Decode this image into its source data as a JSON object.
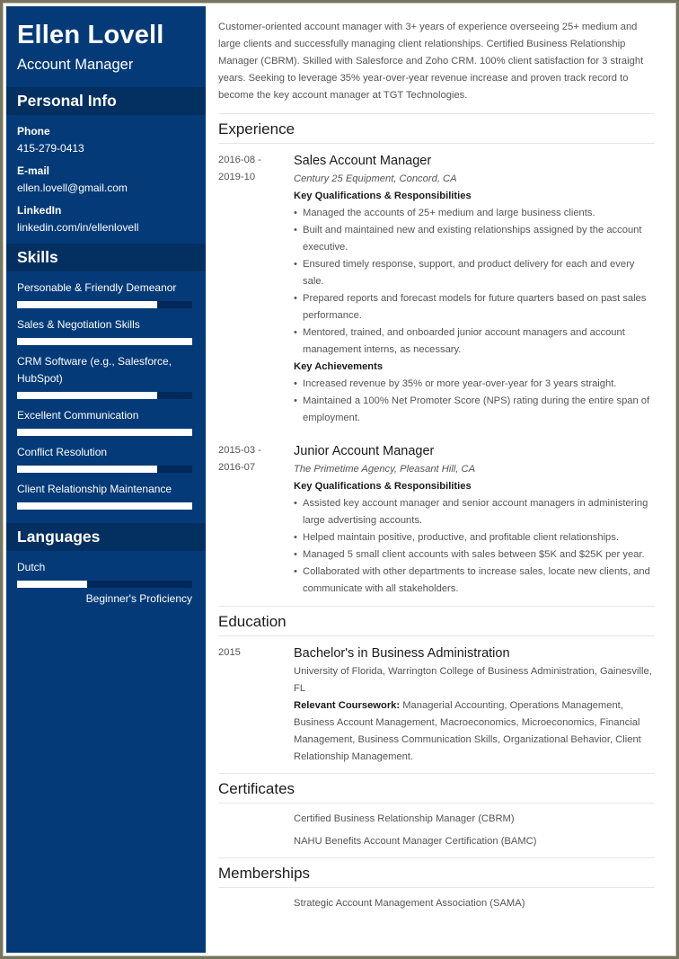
{
  "header": {
    "name": "Ellen Lovell",
    "title": "Account Manager"
  },
  "colors": {
    "sidebar": "#043a78",
    "sidebar_section": "#032f61",
    "frame": "#75755f"
  },
  "personal_info": {
    "title": "Personal Info",
    "items": [
      {
        "label": "Phone",
        "value": "415-279-0413"
      },
      {
        "label": "E-mail",
        "value": "ellen.lovell@gmail.com"
      },
      {
        "label": "LinkedIn",
        "value": "linkedin.com/in/ellenlovell"
      }
    ]
  },
  "skills": {
    "title": "Skills",
    "items": [
      {
        "label": "Personable & Friendly Demeanor",
        "level_percent": 80
      },
      {
        "label": "Sales & Negotiation Skills",
        "level_percent": 100
      },
      {
        "label": "CRM Software (e.g., Salesforce, HubSpot)",
        "level_percent": 80
      },
      {
        "label": "Excellent Communication",
        "level_percent": 100
      },
      {
        "label": "Conflict Resolution",
        "level_percent": 80
      },
      {
        "label": "Client Relationship Maintenance",
        "level_percent": 100
      }
    ]
  },
  "languages": {
    "title": "Languages",
    "items": [
      {
        "label": "Dutch",
        "level_percent": 40,
        "proficiency": "Beginner's Proficiency"
      }
    ]
  },
  "summary": "Customer-oriented account manager with 3+ years of experience overseeing 25+ medium and large clients and successfully managing client relationships. Certified Business Relationship Manager (CBRM). Skilled with Salesforce and Zoho CRM. 100% client satisfaction for 3 straight years. Seeking to leverage 35% year-over-year revenue increase and proven track record to become the key account manager at TGT Technologies.",
  "experience": {
    "title": "Experience",
    "jobs": [
      {
        "date_start": "2016-08 -",
        "date_end": "2019-10",
        "title": "Sales Account Manager",
        "company": "Century 25 Equipment, Concord, CA",
        "qual_heading": "Key Qualifications & Responsibilities",
        "responsibilities": [
          "Managed the accounts of 25+ medium and large business clients.",
          "Built and maintained new and existing relationships assigned by the account executive.",
          "Ensured timely response, support, and product delivery for each and every sale.",
          "Prepared reports and forecast models for future quarters based on past sales performance.",
          "Mentored, trained, and onboarded junior account managers and account management interns, as necessary."
        ],
        "ach_heading": "Key Achievements",
        "achievements": [
          "Increased revenue by 35% or more year-over-year for 3 years straight.",
          "Maintained a 100% Net Promoter Score (NPS) rating during the entire span of employment."
        ]
      },
      {
        "date_start": "2015-03 -",
        "date_end": "2016-07",
        "title": "Junior Account Manager",
        "company": "The Primetime Agency, Pleasant Hill, CA",
        "qual_heading": "Key Qualifications & Responsibilities",
        "responsibilities": [
          "Assisted key account manager and senior account managers in administering large advertising accounts.",
          "Helped maintain positive, productive, and profitable client relationships.",
          "Managed 5 small client accounts with sales between $5K and $25K per year.",
          "Collaborated with other departments to increase sales, locate new clients, and communicate with all stakeholders."
        ]
      }
    ]
  },
  "education": {
    "title": "Education",
    "entries": [
      {
        "date": "2015",
        "degree": "Bachelor's in Business Administration",
        "school": "University of Florida, Warrington College of Business Administration, Gainesville, FL",
        "coursework_label": "Relevant Coursework:",
        "coursework": "Managerial Accounting, Operations Management, Business Account Management, Macroeconomics, Microeconomics, Financial Management, Business Communication Skills, Organizational Behavior, Client Relationship Management."
      }
    ]
  },
  "certificates": {
    "title": "Certificates",
    "items": [
      "Certified Business Relationship Manager (CBRM)",
      "NAHU Benefits Account Manager Certification (BAMC)"
    ]
  },
  "memberships": {
    "title": "Memberships",
    "items": [
      "Strategic Account Management Association (SAMA)"
    ]
  }
}
